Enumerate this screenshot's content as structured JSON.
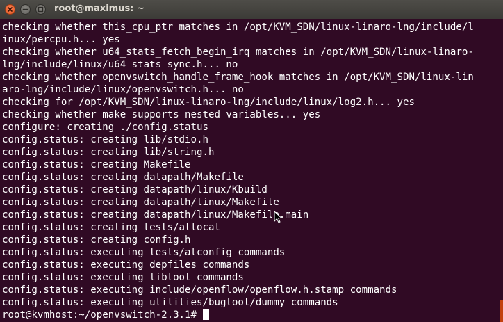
{
  "window": {
    "title": "root@maximus: ~"
  },
  "terminal": {
    "lines": [
      "checking whether this_cpu_ptr matches in /opt/KVM_SDN/linux-linaro-lng/include/l",
      "inux/percpu.h... yes",
      "checking whether u64_stats_fetch_begin_irq matches in /opt/KVM_SDN/linux-linaro-",
      "lng/include/linux/u64_stats_sync.h... no",
      "checking whether openvswitch_handle_frame_hook matches in /opt/KVM_SDN/linux-lin",
      "aro-lng/include/linux/openvswitch.h... no",
      "checking for /opt/KVM_SDN/linux-linaro-lng/include/linux/log2.h... yes",
      "checking whether make supports nested variables... yes",
      "configure: creating ./config.status",
      "config.status: creating lib/stdio.h",
      "config.status: creating lib/string.h",
      "config.status: creating Makefile",
      "config.status: creating datapath/Makefile",
      "config.status: creating datapath/linux/Kbuild",
      "config.status: creating datapath/linux/Makefile",
      "config.status: creating datapath/linux/Makefile.main",
      "config.status: creating tests/atlocal",
      "config.status: creating config.h",
      "config.status: executing tests/atconfig commands",
      "config.status: executing depfiles commands",
      "config.status: executing libtool commands",
      "config.status: executing include/openflow/openflow.h.stamp commands",
      "config.status: executing utilities/bugtool/dummy commands"
    ],
    "prompt": "root@kvmhost:~/openvswitch-2.3.1# "
  },
  "colors": {
    "background": "#300a24",
    "text": "#ffffff",
    "titlebar": "#3c3b37",
    "close_button": "#e2541d",
    "scroll_thumb": "#c2410f"
  },
  "icons": [
    "close-icon",
    "minimize-icon",
    "maximize-icon",
    "mouse-text-cursor-icon"
  ]
}
